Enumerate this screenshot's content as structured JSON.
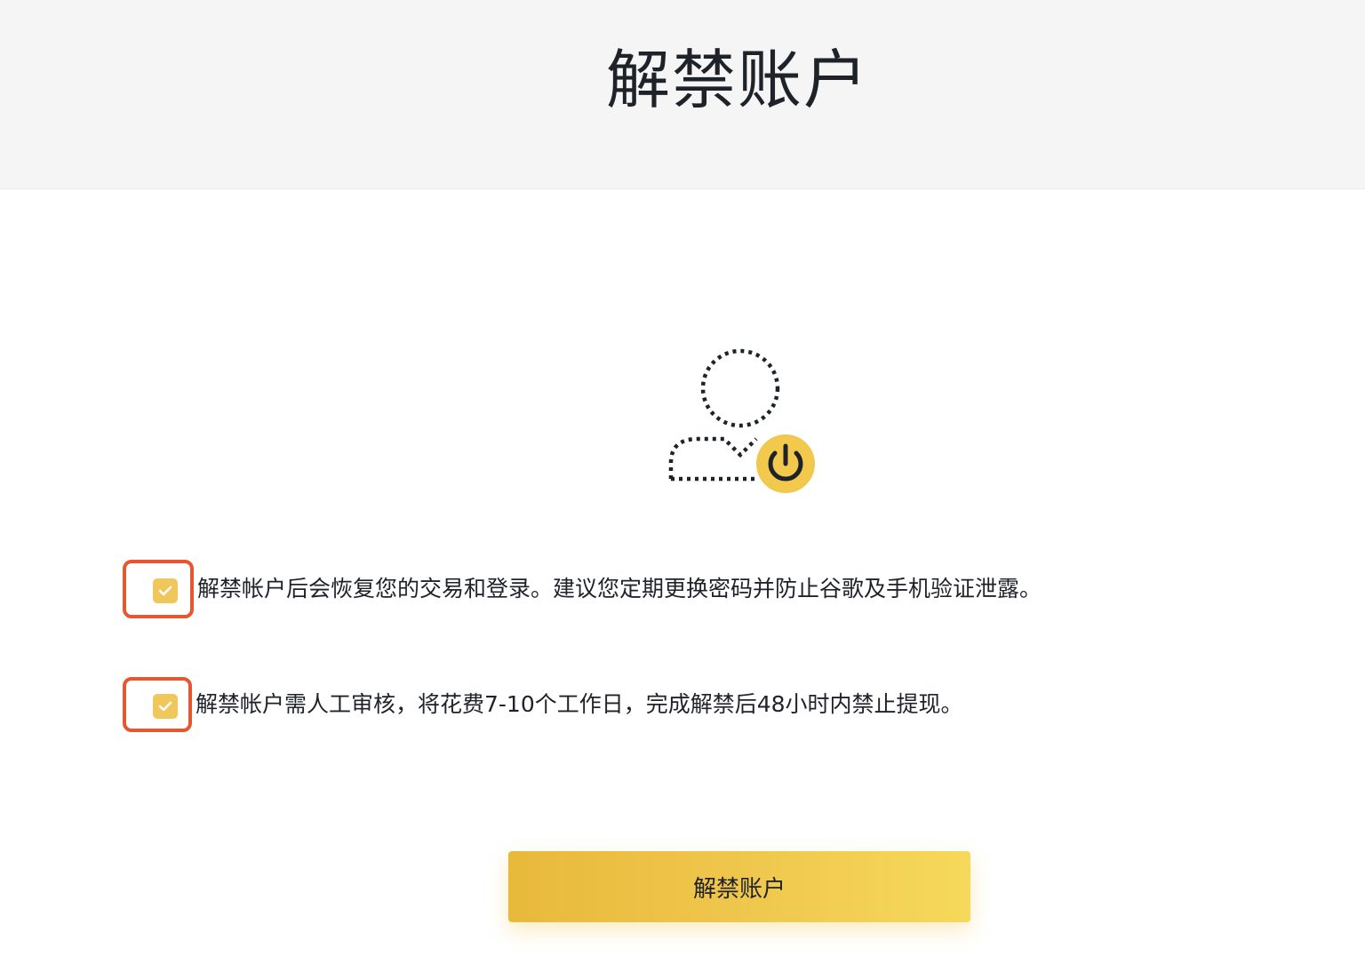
{
  "header": {
    "title": "解禁账户"
  },
  "illustration": {
    "icon": "user-unlock-icon",
    "badge_icon": "power-icon",
    "accent_color": "#f0c84e"
  },
  "agreements": [
    {
      "checked": true,
      "text": "解禁帐户后会恢复您的交易和登录。建议您定期更换密码并防止谷歌及手机验证泄露。"
    },
    {
      "checked": true,
      "text": "解禁帐户需人工审核，将花费7-10个工作日，完成解禁后48小时内禁止提现。"
    }
  ],
  "actions": {
    "submit_label": "解禁账户"
  },
  "colors": {
    "header_bg": "#f5f5f5",
    "checkbox": "#f0c75a",
    "highlight": "#e8562e",
    "text": "#1e2329"
  }
}
